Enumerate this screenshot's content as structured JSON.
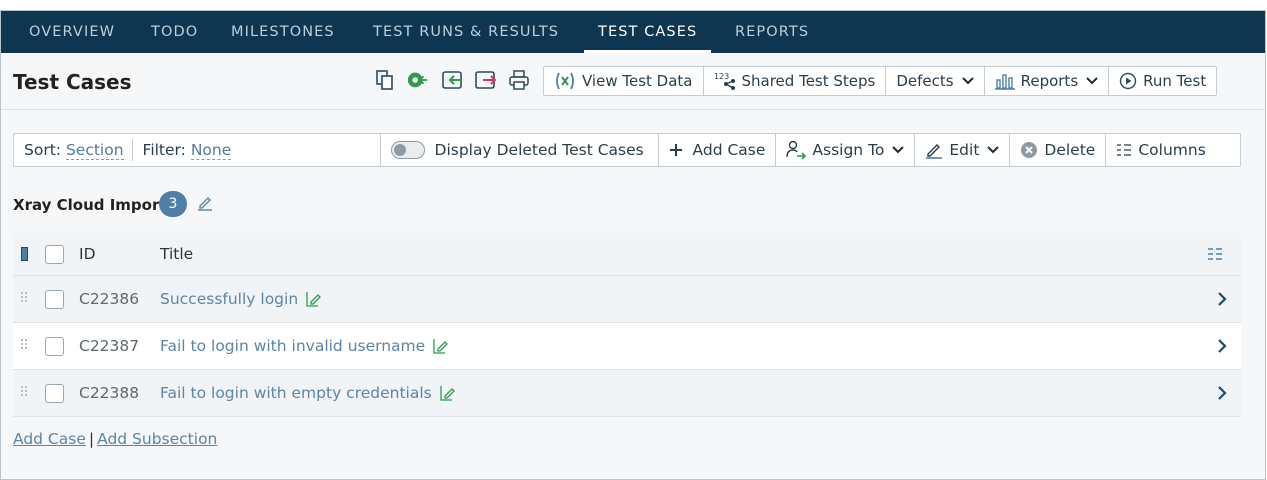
{
  "nav": {
    "tabs": [
      {
        "label": "OVERVIEW"
      },
      {
        "label": "TODO"
      },
      {
        "label": "MILESTONES"
      },
      {
        "label": "TEST RUNS & RESULTS"
      },
      {
        "label": "TEST CASES",
        "active": true
      },
      {
        "label": "REPORTS"
      }
    ]
  },
  "header": {
    "title": "Test Cases",
    "icons": [
      "copy-icon",
      "add-green-icon",
      "import-icon",
      "export-icon",
      "print-icon"
    ],
    "buttons": {
      "view_test_data": "View Test Data",
      "shared_test_steps": "Shared Test Steps",
      "defects": "Defects",
      "reports": "Reports",
      "run_test": "Run Test"
    }
  },
  "toolbar": {
    "sort_label": "Sort:",
    "sort_value": "Section",
    "filter_label": "Filter:",
    "filter_value": "None",
    "display_deleted": "Display Deleted Test Cases",
    "add_case": "Add Case",
    "assign_to": "Assign To",
    "edit": "Edit",
    "delete": "Delete",
    "columns": "Columns"
  },
  "section": {
    "title": "Xray Cloud Import",
    "count": "3"
  },
  "table": {
    "headers": {
      "id": "ID",
      "title": "Title"
    },
    "rows": [
      {
        "id": "C22386",
        "title": "Successfully login"
      },
      {
        "id": "C22387",
        "title": "Fail to login with invalid username"
      },
      {
        "id": "C22388",
        "title": "Fail to login with empty credentials"
      }
    ]
  },
  "footer": {
    "add_case": "Add Case",
    "separator": "|",
    "add_subsection": "Add Subsection"
  },
  "colors": {
    "nav_bg": "#0f3650",
    "link": "#5d85a6",
    "badge": "#4e7fa7",
    "accent_green": "#2e9b4a"
  }
}
